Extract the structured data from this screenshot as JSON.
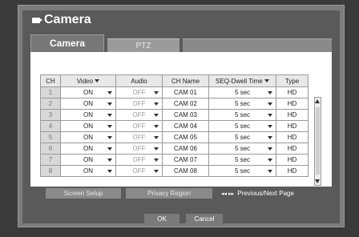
{
  "title": "Camera",
  "tabs": [
    {
      "label": "Camera"
    },
    {
      "label": "PTZ"
    }
  ],
  "columns": [
    "CH",
    "Video",
    "Audio",
    "CH Name",
    "SEQ-Dwell Time",
    "Type"
  ],
  "rows": [
    {
      "ch": "1",
      "video": "ON",
      "audio": "OFF",
      "name": "CAM 01",
      "dwell": "5 sec",
      "type": "HD"
    },
    {
      "ch": "2",
      "video": "ON",
      "audio": "OFF",
      "name": "CAM 02",
      "dwell": "5 sec",
      "type": "HD"
    },
    {
      "ch": "3",
      "video": "ON",
      "audio": "OFF",
      "name": "CAM 03",
      "dwell": "5 sec",
      "type": "HD"
    },
    {
      "ch": "4",
      "video": "ON",
      "audio": "OFF",
      "name": "CAM 04",
      "dwell": "5 sec",
      "type": "HD"
    },
    {
      "ch": "5",
      "video": "ON",
      "audio": "OFF",
      "name": "CAM 05",
      "dwell": "5 sec",
      "type": "HD"
    },
    {
      "ch": "6",
      "video": "ON",
      "audio": "OFF",
      "name": "CAM 06",
      "dwell": "5 sec",
      "type": "HD"
    },
    {
      "ch": "7",
      "video": "ON",
      "audio": "OFF",
      "name": "CAM 07",
      "dwell": "5 sec",
      "type": "HD"
    },
    {
      "ch": "8",
      "video": "ON",
      "audio": "OFF",
      "name": "CAM 08",
      "dwell": "5 sec",
      "type": "HD"
    }
  ],
  "buttons": {
    "screen_setup": "Screen Setup",
    "privacy_region": "Privacy Region",
    "pager_symbol": "◂◂ ▸▸",
    "pager_label": "Previous/Next Page",
    "ok": "OK",
    "cancel": "Cancel"
  },
  "icons": [
    "camera-icon",
    "dropdown-arrow-icon",
    "scroll-up-icon",
    "scroll-down-icon",
    "prev-next-page-icon"
  ]
}
